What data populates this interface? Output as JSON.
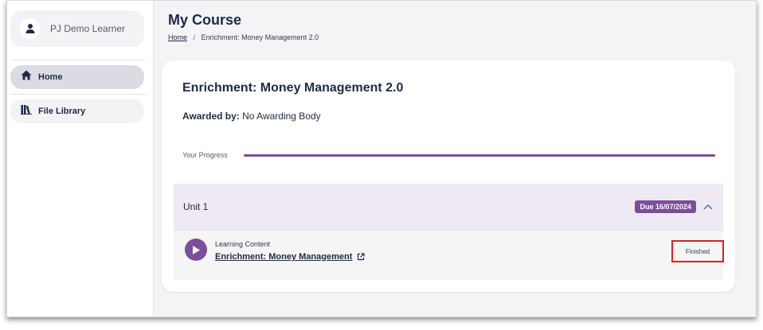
{
  "sidebar": {
    "user_name": "PJ Demo Learner",
    "items": [
      {
        "label": "Home",
        "icon": "home-icon",
        "active": true
      },
      {
        "label": "File Library",
        "icon": "library-icon",
        "active": false
      }
    ]
  },
  "header": {
    "title": "My Course",
    "breadcrumb": {
      "home": "Home",
      "separator": "/",
      "current": "Enrichment: Money Management 2.0"
    }
  },
  "course": {
    "title": "Enrichment: Money Management 2.0",
    "awarded_label": "Awarded by:",
    "awarded_value": "No Awarding Body",
    "progress_label": "Your Progress",
    "progress_fraction": 1.0
  },
  "unit": {
    "title": "Unit 1",
    "due": "Due 16/07/2024",
    "content": {
      "type": "Learning Content",
      "link": "Enrichment: Money Management",
      "status": "Finished"
    }
  },
  "colors": {
    "accent": "#7b4e99",
    "navy": "#1f2a44",
    "highlight": "#d9202a"
  }
}
